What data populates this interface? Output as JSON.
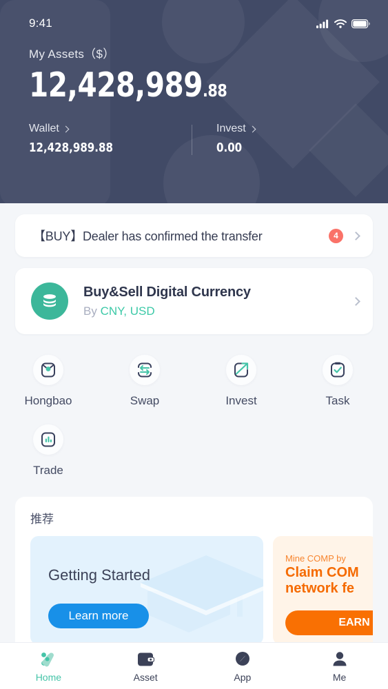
{
  "status_bar": {
    "time": "9:41",
    "icons": [
      "cellular-signal-icon",
      "wifi-icon",
      "battery-icon"
    ]
  },
  "header": {
    "assets_label": "My Assets（$）",
    "amount_main": "12,428,989",
    "amount_cents": ".88",
    "stats": [
      {
        "name": "Wallet",
        "value": "12,428,989.88"
      },
      {
        "name": "Invest",
        "value": "0.00"
      }
    ]
  },
  "notice": {
    "text": "【BUY】Dealer has confirmed the transfer",
    "badge_count": "4"
  },
  "promo": {
    "title": "Buy&Sell Digital Currency",
    "by_label": "By",
    "currencies": "CNY, USD",
    "icon": "coin-stack-icon"
  },
  "quick_actions": [
    {
      "label": "Hongbao",
      "icon": "red-envelope-icon"
    },
    {
      "label": "Swap",
      "icon": "swap-arrows-icon"
    },
    {
      "label": "Invest",
      "icon": "arrow-out-icon"
    },
    {
      "label": "Task",
      "icon": "clipboard-check-icon"
    },
    {
      "label": "Trade",
      "icon": "bar-chart-icon"
    }
  ],
  "recommend": {
    "heading": "推荐",
    "cards": [
      {
        "title": "Getting Started",
        "button": "Learn more",
        "graphic": "graduation-cap-icon"
      },
      {
        "small": "Mine COMP by",
        "big": "Claim COM\nnetwork fe",
        "button": "EARN"
      }
    ]
  },
  "tabbar": [
    {
      "label": "Home",
      "icon": "home-logo-icon",
      "active": true
    },
    {
      "label": "Asset",
      "icon": "wallet-icon",
      "active": false
    },
    {
      "label": "App",
      "icon": "compass-icon",
      "active": false
    },
    {
      "label": "Me",
      "icon": "person-icon",
      "active": false
    }
  ],
  "colors": {
    "header_bg": "#414a66",
    "teal": "#3cb79a",
    "accent_teal": "#45c4a8",
    "badge_red": "#fa7268",
    "blue": "#1890e8",
    "orange": "#f97003",
    "dark_text": "#3c4258"
  }
}
